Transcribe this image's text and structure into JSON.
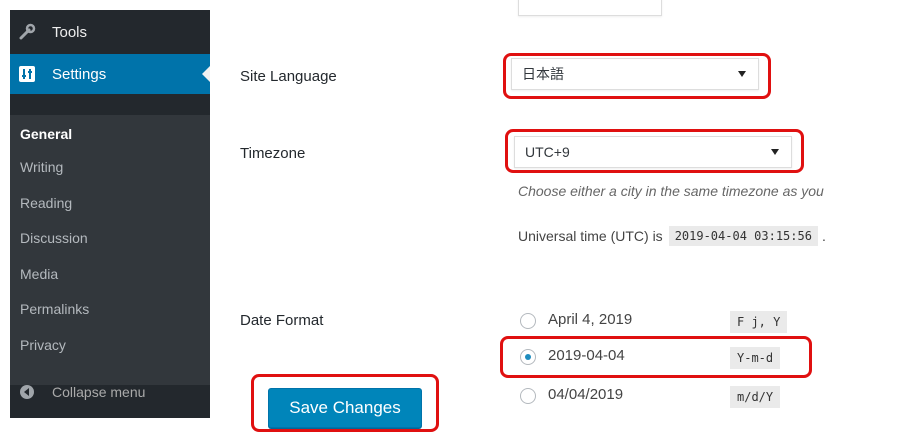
{
  "sidebar": {
    "tools_label": "Tools",
    "settings_label": "Settings",
    "submenu": [
      "General",
      "Writing",
      "Reading",
      "Discussion",
      "Media",
      "Permalinks",
      "Privacy"
    ],
    "collapse_label": "Collapse menu"
  },
  "form": {
    "site_language": {
      "label": "Site Language",
      "value": "日本語"
    },
    "timezone": {
      "label": "Timezone",
      "value": "UTC+9",
      "description": "Choose either a city in the same timezone as you",
      "utc_text": "Universal time (UTC) is",
      "utc_value": "2019-04-04 03:15:56",
      "utc_suffix": "."
    },
    "date_format": {
      "label": "Date Format",
      "options": [
        {
          "label": "April 4, 2019",
          "code": "F j, Y",
          "selected": false
        },
        {
          "label": "2019-04-04",
          "code": "Y-m-d",
          "selected": true
        },
        {
          "label": "04/04/2019",
          "code": "m/d/Y",
          "selected": false
        }
      ]
    },
    "save_label": "Save Changes"
  },
  "colors": {
    "sidebar_bg": "#23282d",
    "submenu_bg": "#32373c",
    "active_blue": "#0073aa",
    "button_blue": "#0085ba",
    "highlight_red": "#e01010"
  }
}
